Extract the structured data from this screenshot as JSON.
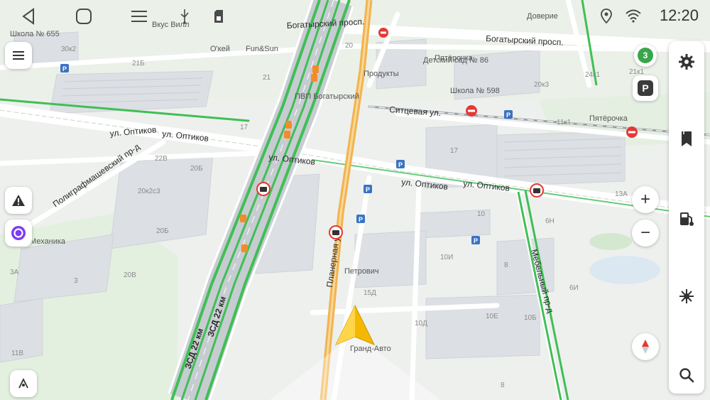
{
  "status_bar": {
    "clock": "12:20",
    "icons": [
      "location-pin-icon",
      "wifi-icon",
      "battery-icon"
    ]
  },
  "nav_bar": {
    "buttons": [
      "back-icon",
      "home-icon",
      "recents-menu-icon",
      "usb-icon",
      "sim-card-icon"
    ]
  },
  "map": {
    "streets": {
      "optikov_1": "ул. Оптиков",
      "optikov_2": "ул. Оптиков",
      "optikov_3": "ул. Оптиков",
      "optikov_4": "ул. Оптиков",
      "bogatyrsky_1": "Богатырский просп.",
      "bogatyrsky_2": "Богатырский просп.",
      "sitsevaya": "Ситцевая ул.",
      "planernaya": "Планерная ул.",
      "poligraf": "Полиграфмашевский пр-д",
      "mebelny": "Мебельный пр-д",
      "zsd_1": "ЗСД 22 км",
      "zsd_2": "ЗСД 22 км"
    },
    "pois": {
      "okey": "О'кей",
      "funsun": "Fun&Sun",
      "produkty": "Продукты",
      "pvp": "ПВП Богатырский",
      "pyaterochka_1": "Пятёрочка",
      "pyaterochka_2": "Пятёрочка",
      "detsad": "Детский сад № 86",
      "shkola598": "Школа № 598",
      "shkola655": "Школа № 655",
      "mekhanika": "Механика",
      "petrovich": "Петрович",
      "grand_avto": "Гранд-Авто",
      "vkusvill": "Вкус Вилл",
      "doverie": "Доверие"
    },
    "house_numbers": {
      "h21b": "21Б",
      "h21": "21",
      "h20": "20",
      "h30k2": "30к2",
      "h17a": "17",
      "h17b": "17",
      "h22v": "22В",
      "h20b": "20Б",
      "h20k2s3": "20к2с3",
      "h20v": "20В",
      "h3a": "3А",
      "h3": "3",
      "h11v": "11В",
      "h10": "10",
      "h10i": "10И",
      "h8a": "8",
      "h8b": "8",
      "h15d": "15Д",
      "h10d": "10Д",
      "h10e": "10Е",
      "h10b": "10Б",
      "h6n": "6Н",
      "h6i": "6И",
      "h13a": "13А",
      "h11k1": "11к1",
      "h20k3": "20к3",
      "h21k1": "21к1",
      "h24k1": "24к1"
    }
  },
  "controls": {
    "speed_limit": "3",
    "parking": "P",
    "zoom_in": "+",
    "zoom_out": "−"
  },
  "colors": {
    "traffic_free": "#3fbf55",
    "road_orange": "#f2b44f",
    "navigator_arrow": "#f5b800",
    "water_blue": "#cfe3f5",
    "park_green": "#d7ecd4"
  }
}
